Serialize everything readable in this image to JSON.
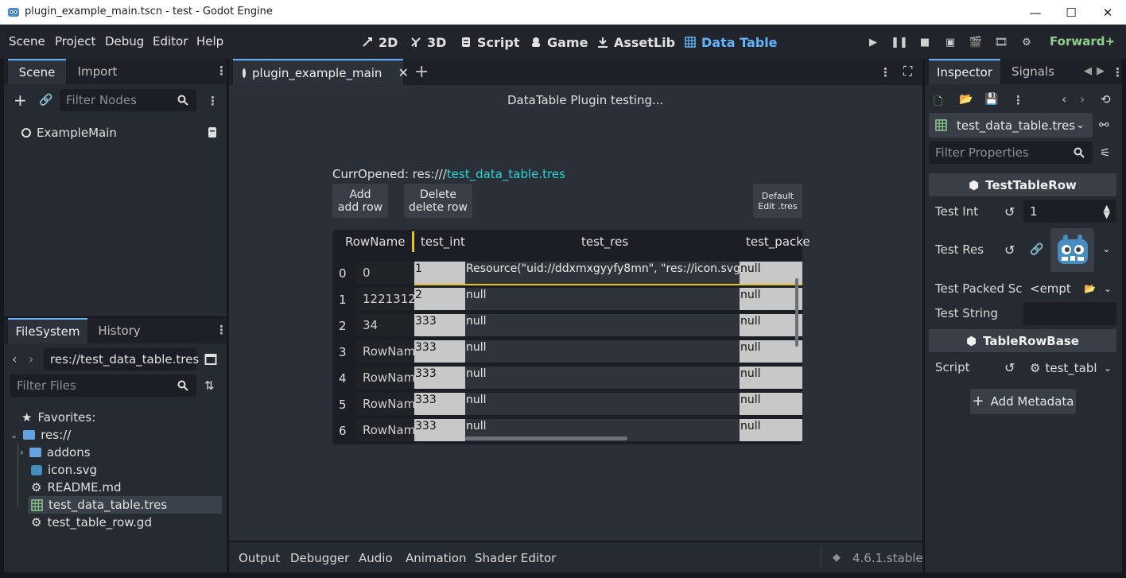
{
  "window": {
    "title": "plugin_example_main.tscn - test - Godot Engine",
    "minimize": "—",
    "maximize": "☐",
    "close": "✕"
  },
  "menubar": {
    "items": [
      "Scene",
      "Project",
      "Debug",
      "Editor",
      "Help"
    ],
    "workspaces": [
      "2D",
      "3D",
      "Script",
      "Game",
      "AssetLib",
      "Data Table"
    ],
    "active_workspace": "Data Table",
    "renderer": "Forward+"
  },
  "scene_dock": {
    "tabs": [
      "Scene",
      "Import"
    ],
    "filter_placeholder": "Filter Nodes",
    "root_node": "ExampleMain"
  },
  "filesystem_dock": {
    "tabs": [
      "FileSystem",
      "History"
    ],
    "path": "res://test_data_table.tres",
    "filter_placeholder": "Filter Files",
    "tree": {
      "favorites": "Favorites:",
      "root": "res://",
      "items": [
        "addons",
        "icon.svg",
        "README.md",
        "test_data_table.tres",
        "test_table_row.gd"
      ],
      "selected": "test_data_table.tres"
    }
  },
  "editor": {
    "tab_title": "plugin_example_main",
    "header": "DataTable Plugin testing...",
    "curr_opened_label": "CurrOpened: res:///",
    "curr_opened_file": "test_data_table.tres",
    "buttons": {
      "add_line1": "Add",
      "add_line2": "add row",
      "delete_line1": "Delete",
      "delete_line2": "delete row",
      "default_line1": "Default",
      "default_line2": "Edit .tres"
    },
    "table": {
      "headers": [
        "RowName",
        "test_int",
        "test_res",
        "test_packe"
      ],
      "rows": [
        {
          "index": "0",
          "name": "0",
          "int": "1",
          "res": "Resource(\"uid://ddxmxgyyfy8mn\", \"res://icon.svg\")",
          "packed": "null"
        },
        {
          "index": "1",
          "name": "1221312",
          "int": "2",
          "res": "null",
          "packed": "null"
        },
        {
          "index": "2",
          "name": "34",
          "int": "333",
          "res": "null",
          "packed": "null"
        },
        {
          "index": "3",
          "name": "RowNam",
          "int": "333",
          "res": "null",
          "packed": "null"
        },
        {
          "index": "4",
          "name": "RowNam",
          "int": "333",
          "res": "null",
          "packed": "null"
        },
        {
          "index": "5",
          "name": "RowNam",
          "int": "333",
          "res": "null",
          "packed": "null"
        },
        {
          "index": "6",
          "name": "RowNam",
          "int": "333",
          "res": "null",
          "packed": "null"
        }
      ]
    }
  },
  "bottom_panel": {
    "tabs": [
      "Output",
      "Debugger",
      "Audio",
      "Animation",
      "Shader Editor"
    ],
    "version": "4.6.1.stable"
  },
  "inspector": {
    "tabs": [
      "Inspector",
      "Signals"
    ],
    "resource": "test_data_table.tres",
    "filter_placeholder": "Filter Properties",
    "section1": "TestTableRow",
    "props": {
      "test_int_label": "Test Int",
      "test_int_value": "1",
      "test_res_label": "Test Res",
      "test_packed_label": "Test Packed Sc",
      "test_packed_value": "<empt",
      "test_string_label": "Test String"
    },
    "section2": "TableRowBase",
    "script_label": "Script",
    "script_value": "test_tabl",
    "add_metadata": "Add Metadata"
  },
  "colors": {
    "accent": "#63b3ff",
    "link": "#2ad6d6",
    "highlight": "#e6c229"
  }
}
